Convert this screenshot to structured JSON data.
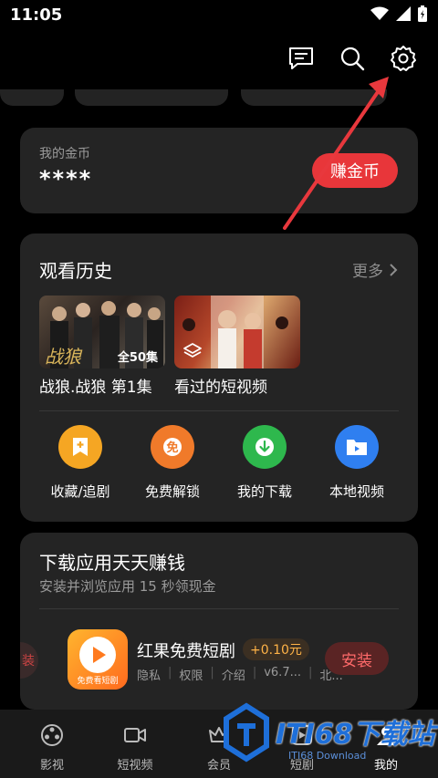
{
  "status_bar": {
    "time": "11:05"
  },
  "coins": {
    "label": "我的金币",
    "value": "****",
    "earn_button": "赚金币"
  },
  "history": {
    "title": "观看历史",
    "more": "更多",
    "items": [
      {
        "title": "战狼.战狼 第1集",
        "caption": "全50集"
      },
      {
        "title": "看过的短视频"
      }
    ]
  },
  "quick_actions": [
    {
      "label": "收藏/追剧",
      "icon": "bookmark-icon",
      "color": "#f5a623"
    },
    {
      "label": "免费解锁",
      "icon": "free-unlock-icon",
      "color": "#f07a2a"
    },
    {
      "label": "我的下载",
      "icon": "download-icon",
      "color": "#2eb84d"
    },
    {
      "label": "本地视频",
      "icon": "folder-icon",
      "color": "#2f7ff0"
    }
  ],
  "earn": {
    "title": "下载应用天天赚钱",
    "subtitle": "安装并浏览应用 15 秒领现金",
    "app": {
      "name": "红果免费短剧",
      "icon_text": "免费看短剧",
      "reward": "+0.10元",
      "meta": [
        "隐私",
        "权限",
        "介绍",
        "v6.7...",
        "北..."
      ],
      "install": "安装"
    }
  },
  "bottom_nav": [
    {
      "label": "影视",
      "icon": "film-reel-icon",
      "active": false
    },
    {
      "label": "短视频",
      "icon": "video-camera-icon",
      "active": false
    },
    {
      "label": "会员",
      "icon": "vip-icon",
      "active": false
    },
    {
      "label": "短剧",
      "icon": "short-drama-icon",
      "active": false
    },
    {
      "label": "我的",
      "icon": "profile-icon",
      "active": true
    }
  ],
  "watermark": {
    "text": "ITI68下载站",
    "sub": "ITI68 Download"
  },
  "colors": {
    "accent_red": "#e8363a",
    "card_bg": "#242424",
    "arrow": "#e8383d"
  }
}
